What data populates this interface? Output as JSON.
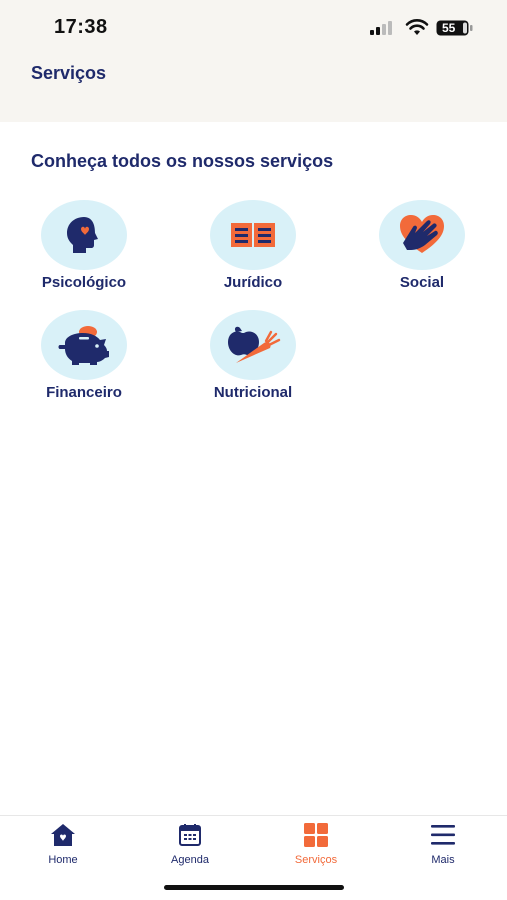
{
  "status_bar": {
    "time": "17:38",
    "battery": "55"
  },
  "header": {
    "title": "Serviços"
  },
  "section": {
    "heading": "Conheça todos os nossos serviços"
  },
  "services": [
    {
      "label": "Psicológico",
      "icon": "head-heart-icon"
    },
    {
      "label": "Jurídico",
      "icon": "open-book-icon"
    },
    {
      "label": "Social",
      "icon": "hand-heart-icon"
    },
    {
      "label": "Financeiro",
      "icon": "piggy-bank-icon"
    },
    {
      "label": "Nutricional",
      "icon": "apple-carrot-icon"
    }
  ],
  "tabbar": {
    "items": [
      {
        "label": "Home",
        "icon": "home-icon",
        "active": false
      },
      {
        "label": "Agenda",
        "icon": "calendar-icon",
        "active": false
      },
      {
        "label": "Serviços",
        "icon": "grid-icon",
        "active": true
      },
      {
        "label": "Mais",
        "icon": "menu-icon",
        "active": false
      }
    ]
  },
  "colors": {
    "primary": "#1f2a6b",
    "accent": "#f26a3a",
    "icon_bg": "#d9f1f8",
    "header_bg": "#f7f5f1"
  }
}
